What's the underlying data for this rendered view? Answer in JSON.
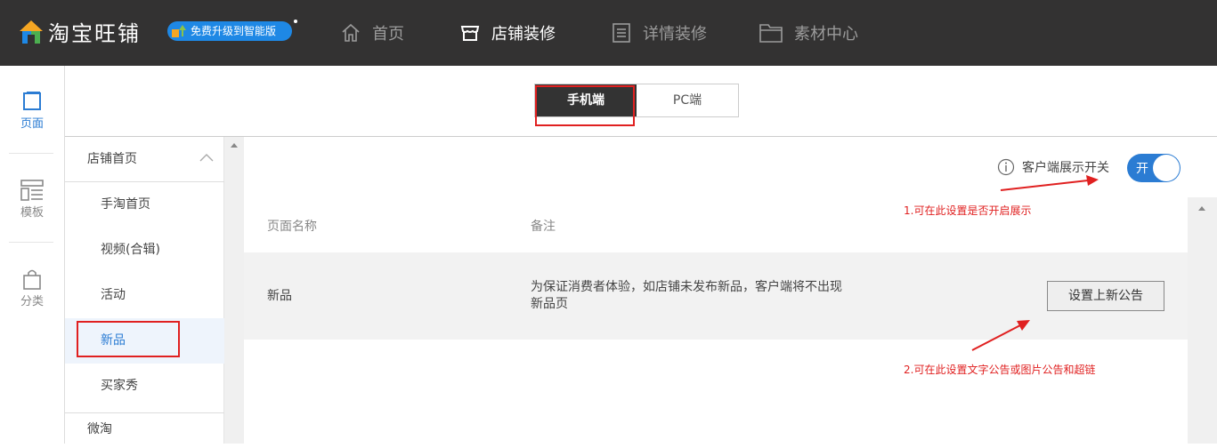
{
  "header": {
    "logo_text": "淘宝旺铺",
    "upgrade_label": "免费升级到智能版",
    "nav": [
      {
        "label": "首页",
        "icon": "home-icon"
      },
      {
        "label": "店铺装修",
        "icon": "store-icon"
      },
      {
        "label": "详情装修",
        "icon": "document-icon"
      },
      {
        "label": "素材中心",
        "icon": "folder-icon"
      }
    ]
  },
  "leftnav": {
    "items": [
      {
        "label": "页面",
        "icon": "page-icon"
      },
      {
        "label": "模板",
        "icon": "template-icon"
      },
      {
        "label": "分类",
        "icon": "bag-icon"
      }
    ]
  },
  "tabs": {
    "mobile": "手机端",
    "pc": "PC端"
  },
  "categories": {
    "header": "店铺首页",
    "items": [
      "手淘首页",
      "视频(合辑)",
      "活动",
      "新品",
      "买家秀"
    ],
    "footer": "微淘"
  },
  "main": {
    "toggle_label": "客户端展示开关",
    "toggle_state": "开",
    "columns": [
      "页面名称",
      "备注"
    ],
    "rows": [
      {
        "name": "新品",
        "note": "为保证消费者体验，如店铺未发布新品，客户端将不出现新品页",
        "action": "设置上新公告"
      }
    ]
  },
  "annotations": {
    "a1": "1.可在此设置是否开启展示",
    "a2": "2.可在此设置文字公告或图片公告和超链"
  },
  "colors": {
    "topbar": "#333232",
    "accent": "#2b7cd3",
    "annotation_red": "#e02020"
  }
}
